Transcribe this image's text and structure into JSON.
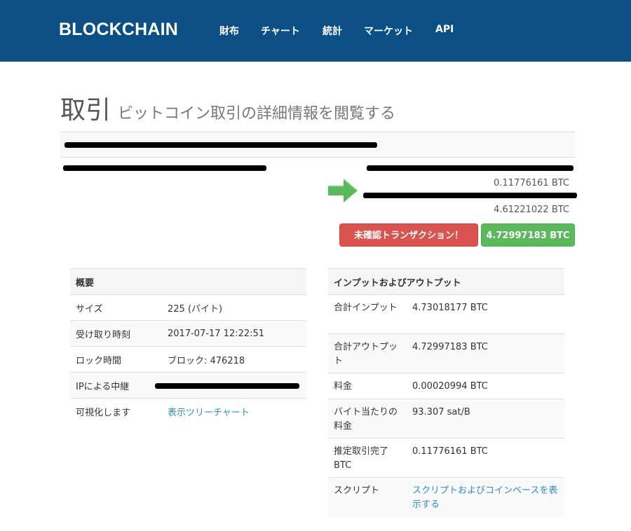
{
  "navbar": {
    "brand": "BLOCKCHAIN",
    "items": [
      {
        "label": "財布"
      },
      {
        "label": "チャート"
      },
      {
        "label": "統計"
      },
      {
        "label": "マーケット"
      },
      {
        "label": "API"
      }
    ]
  },
  "page": {
    "title": "取引",
    "subtitle": "ビットコイン取引の詳細情報を閲覧する"
  },
  "transaction": {
    "hash": "",
    "from_address": "",
    "outputs": [
      {
        "address": "",
        "amount": "0.11776161 BTC"
      },
      {
        "address": "",
        "amount": "4.61221022 BTC"
      }
    ],
    "status_button": "未確認トランザクション！",
    "total_button": "4.72997183 BTC"
  },
  "summary": {
    "header": "概要",
    "rows": [
      {
        "label": "サイズ",
        "value": "225 (バイト)"
      },
      {
        "label": "受け取り時刻",
        "value": "2017-07-17 12:22:51"
      },
      {
        "label": "ロック時間",
        "value": "ブロック: 476218"
      },
      {
        "label": "IPによる中継",
        "value": ""
      },
      {
        "label": "可視化します",
        "value": "表示ツリーチャート"
      }
    ]
  },
  "io": {
    "header": "インプットおよびアウトプット",
    "rows": [
      {
        "label": "合計インプット",
        "value": "4.73018177 BTC"
      },
      {
        "label": "合計アウトプット",
        "value": "4.72997183 BTC"
      },
      {
        "label": "料金",
        "value": "0.00020994 BTC"
      },
      {
        "label": "バイト当たりの料金",
        "value": "93.307 sat/B"
      },
      {
        "label": "推定取引完了BTC",
        "value": "0.11776161 BTC"
      },
      {
        "label": "スクリプト",
        "value": "スクリプトおよびコインベースを表示する"
      }
    ]
  },
  "colors": {
    "navbar": "#0b4f85",
    "link": "#2a8fc6",
    "danger": "#d9534f",
    "success": "#5cb85c",
    "arrow": "#5cb85c"
  },
  "icons": {
    "arrow": "right-arrow-icon"
  }
}
